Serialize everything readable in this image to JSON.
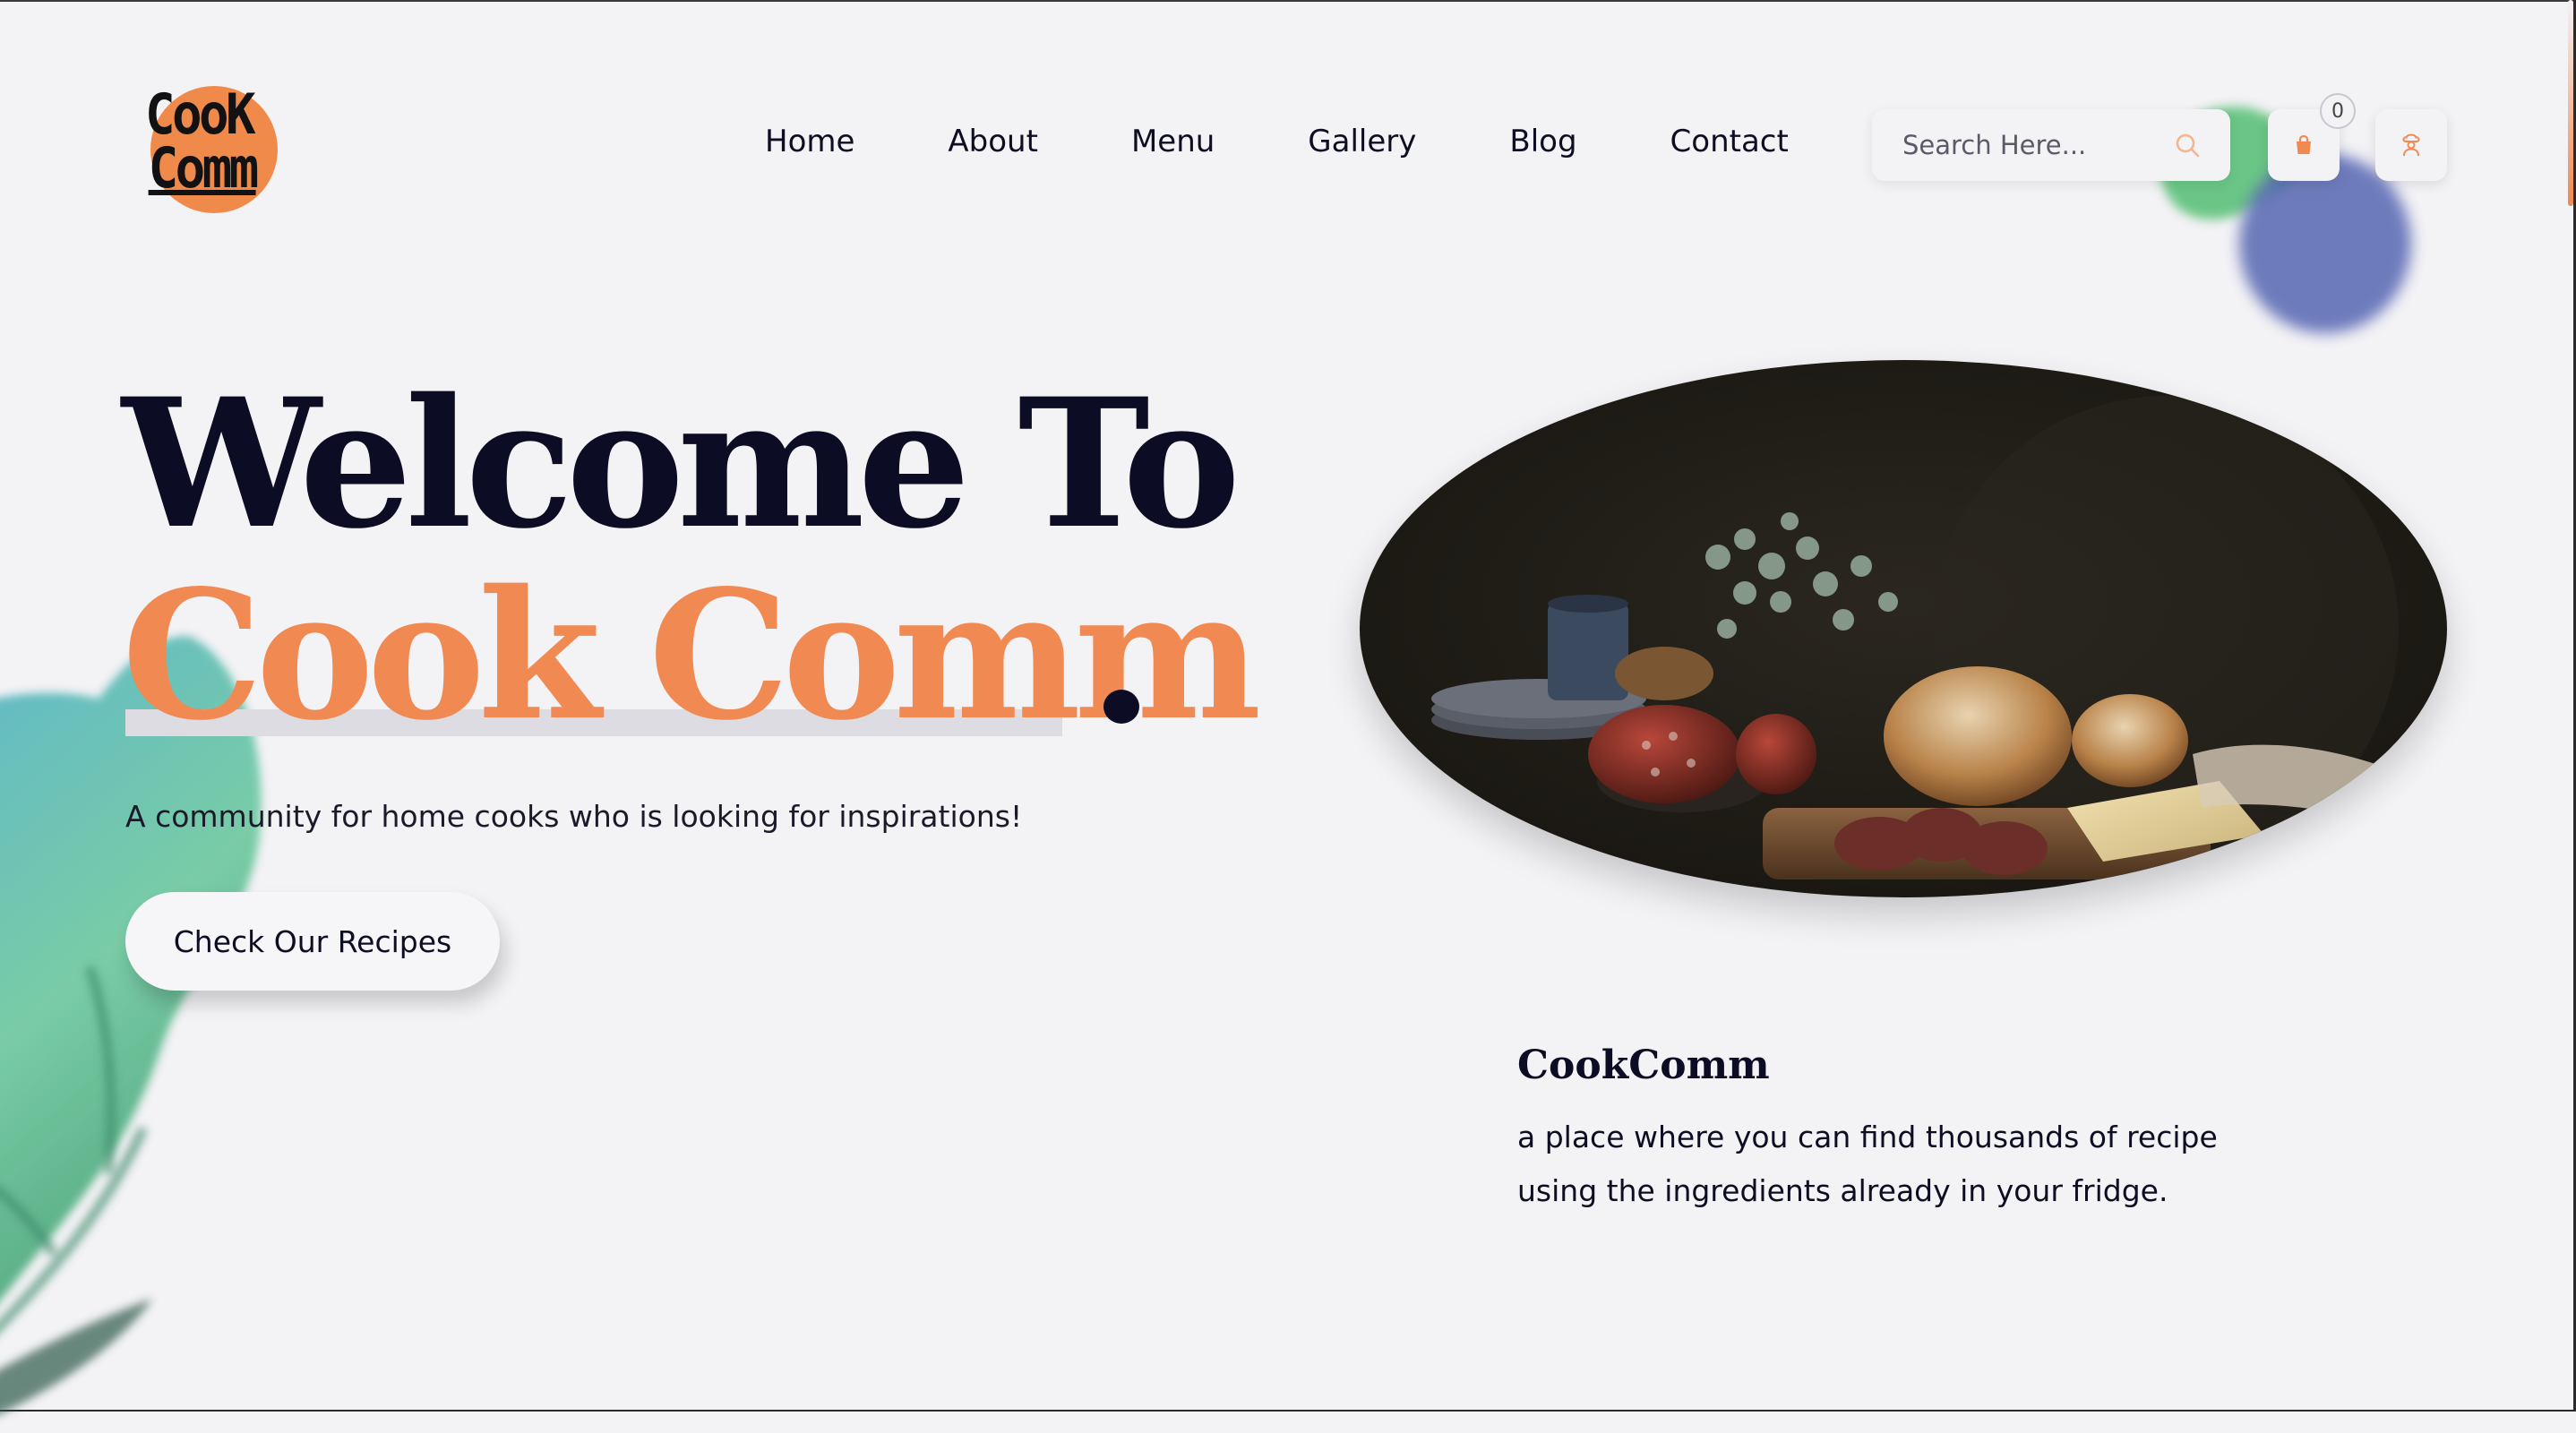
{
  "logo": {
    "line1": "CooK",
    "line2": "Comm"
  },
  "nav": {
    "items": [
      {
        "label": "Home"
      },
      {
        "label": "About"
      },
      {
        "label": "Menu"
      },
      {
        "label": "Gallery"
      },
      {
        "label": "Blog"
      },
      {
        "label": "Contact"
      }
    ]
  },
  "search": {
    "placeholder": "Search Here..."
  },
  "cart": {
    "count": "0"
  },
  "hero": {
    "line1": "Welcome To",
    "line2": "Cook Comm",
    "subtitle": "A community for home cooks who is looking for inspirations!",
    "cta_label": "Check Our Recipes"
  },
  "info": {
    "title": "CookComm",
    "text": "a place where you can find thousands of recipe using the ingredients already in your fridge."
  },
  "colors": {
    "accent": "#f08a52",
    "dark": "#0c0d24",
    "background": "#f3f2f5"
  },
  "icons": {
    "search": "search-icon",
    "cart": "shopping-bag-icon",
    "user": "chef-user-icon"
  }
}
